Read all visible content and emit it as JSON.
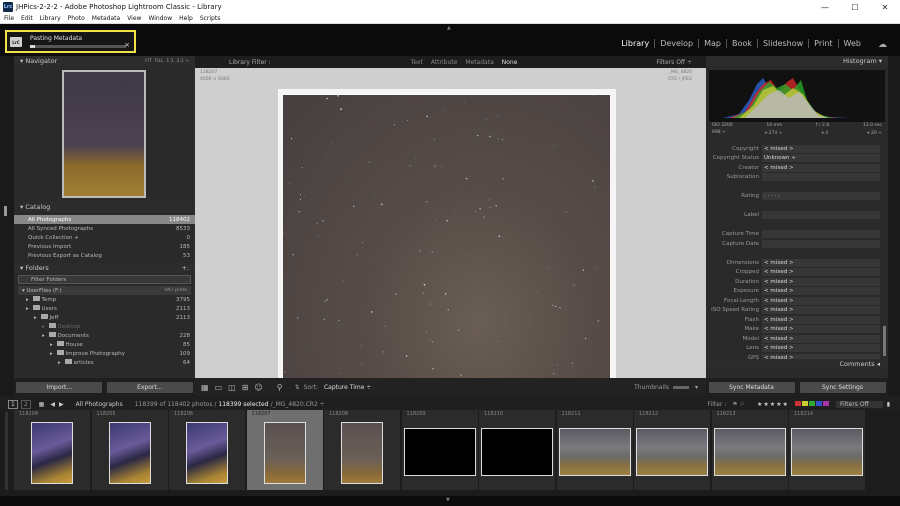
{
  "window": {
    "title": "JHPics-2-2-2 - Adobe Photoshop Lightroom Classic - Library",
    "app_icon": "Lrc",
    "controls": [
      "—",
      "☐",
      "✕"
    ]
  },
  "menu": [
    "File",
    "Edit",
    "Library",
    "Photo",
    "Metadata",
    "View",
    "Window",
    "Help",
    "Scripts"
  ],
  "progress": {
    "title": "Pasting Metadata",
    "percent": 5,
    "close": "×"
  },
  "modules": [
    {
      "label": "Library",
      "active": true
    },
    {
      "label": "Develop"
    },
    {
      "label": "Map"
    },
    {
      "label": "Book"
    },
    {
      "label": "Slideshow"
    },
    {
      "label": "Print"
    },
    {
      "label": "Web"
    }
  ],
  "navigator": {
    "title": "Navigator",
    "zoom": [
      "FIT",
      "FILL",
      "1:1",
      "3:1 ÷"
    ]
  },
  "catalog": {
    "title": "Catalog",
    "items": [
      {
        "label": "All Photographs",
        "count": "118402",
        "selected": true
      },
      {
        "label": "All Synced Photographs",
        "count": "8533"
      },
      {
        "label": "Quick Collection +",
        "count": "0"
      },
      {
        "label": "Previous Import",
        "count": "185"
      },
      {
        "label": "Previous Export as Catalog",
        "count": "53"
      }
    ]
  },
  "folders": {
    "title": "Folders",
    "add": "+.",
    "filter_label": "Filter Folders",
    "volume": "UserFiles (F:)",
    "volume_info": "nN / prnte",
    "rows": [
      {
        "label": "Temp",
        "count": "3795",
        "indent": 1
      },
      {
        "label": "Users",
        "count": "2113",
        "indent": 1
      },
      {
        "label": "Jeff",
        "count": "2113",
        "indent": 2
      },
      {
        "label": "Desktop",
        "count": "",
        "indent": 3,
        "dim": true
      },
      {
        "label": "Documents",
        "count": "228",
        "indent": 3
      },
      {
        "label": "House",
        "count": "85",
        "indent": 4
      },
      {
        "label": "Improve Photography",
        "count": "109",
        "indent": 4
      },
      {
        "label": "articles",
        "count": "64",
        "indent": 5
      }
    ]
  },
  "left_buttons": {
    "import": "Import...",
    "export": "Export..."
  },
  "library_filter": {
    "title": "Library Filter :",
    "options": [
      "Text",
      "Attribute",
      "Metadata",
      "None"
    ],
    "active": "None",
    "filters_off": "Filters Off ÷"
  },
  "loupe": {
    "id": "118207",
    "dims": "4000 × 6000",
    "filename": "_MG_4820",
    "format": "CR2 / JPEG"
  },
  "toolbar": {
    "sort_label": "Sort:",
    "sort_value": "Capture Time ÷",
    "thumbnails": "Thumbnails"
  },
  "histogram": {
    "title": "Histogram",
    "iso": "ISO 3200",
    "focal": "16 mm",
    "aperture": "f / 2.8",
    "shutter": "13.0 sec",
    "crop": "698 ÷",
    "chips": [
      "⌖ 274 ÷",
      "⌖ 4",
      "⌖ 20 ÷"
    ]
  },
  "metadata": [
    {
      "k": "Copyright",
      "v": "< mixed >"
    },
    {
      "k": "Copyright Status",
      "v": "Unknown ÷"
    },
    {
      "k": "Creator",
      "v": "< mixed >"
    },
    {
      "k": "Sublocation",
      "v": ""
    },
    {
      "k": "",
      "v": ""
    },
    {
      "k": "Rating",
      "v": "· · · · ·"
    },
    {
      "k": "",
      "v": ""
    },
    {
      "k": "Label",
      "v": ""
    },
    {
      "k": "",
      "v": ""
    },
    {
      "k": "Capture Time",
      "v": ""
    },
    {
      "k": "Capture Date",
      "v": ""
    },
    {
      "k": "",
      "v": ""
    },
    {
      "k": "Dimensions",
      "v": "< mixed >"
    },
    {
      "k": "Cropped",
      "v": "< mixed >"
    },
    {
      "k": "Duration",
      "v": "< mixed >"
    },
    {
      "k": "Exposure",
      "v": "< mixed >"
    },
    {
      "k": "Focal Length",
      "v": "< mixed >"
    },
    {
      "k": "ISO Speed Rating",
      "v": "< mixed >"
    },
    {
      "k": "Flash",
      "v": "< mixed >"
    },
    {
      "k": "Make",
      "v": "< mixed >"
    },
    {
      "k": "Model",
      "v": "< mixed >"
    },
    {
      "k": "Lens",
      "v": "< mixed >"
    },
    {
      "k": "GPS",
      "v": "< mixed >"
    }
  ],
  "comments": "Comments ◂",
  "sync": {
    "metadata": "Sync Metadata",
    "settings": "Sync Settings"
  },
  "filmbar": {
    "views": [
      "1",
      "2"
    ],
    "source": "All Photographs",
    "count": "118399 of 118402 photos /",
    "selected": "118399 selected",
    "path": "/_MG_4820.CR2 ÷",
    "filter": "Filter :",
    "filters_off": "Filters Off"
  },
  "film": [
    {
      "n": "118204",
      "type": "milky"
    },
    {
      "n": "118205",
      "type": "milky"
    },
    {
      "n": "118206",
      "type": "milky"
    },
    {
      "n": "118207",
      "type": "sky",
      "sel": true
    },
    {
      "n": "118208",
      "type": "sky"
    },
    {
      "n": "118209",
      "type": "black"
    },
    {
      "n": "118210",
      "type": "black"
    },
    {
      "n": "118211",
      "type": "land"
    },
    {
      "n": "118212",
      "type": "land"
    },
    {
      "n": "118213",
      "type": "land"
    },
    {
      "n": "118214",
      "type": "land"
    }
  ],
  "colors": {
    "progress_border": "#f0e04a",
    "selection": "#888888"
  }
}
